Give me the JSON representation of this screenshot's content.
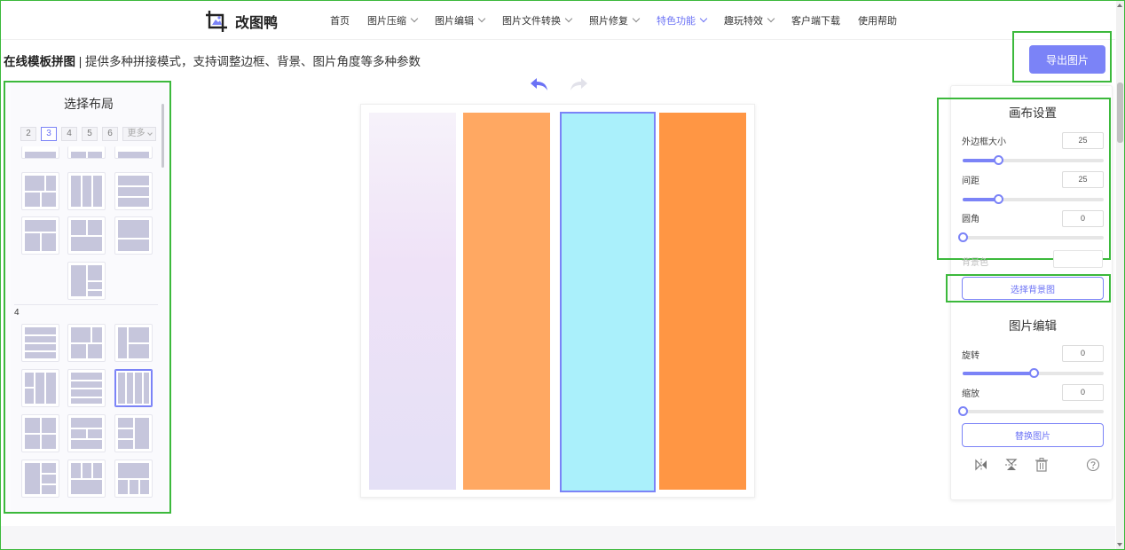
{
  "header": {
    "logo_text": "改图鸭",
    "nav": [
      {
        "label": "首页",
        "dropdown": false,
        "active": false
      },
      {
        "label": "图片压缩",
        "dropdown": true,
        "active": false
      },
      {
        "label": "图片编辑",
        "dropdown": true,
        "active": false
      },
      {
        "label": "图片文件转换",
        "dropdown": true,
        "active": false
      },
      {
        "label": "照片修复",
        "dropdown": true,
        "active": false
      },
      {
        "label": "特色功能",
        "dropdown": true,
        "active": true
      },
      {
        "label": "趣玩特效",
        "dropdown": true,
        "active": false
      },
      {
        "label": "客户端下载",
        "dropdown": false,
        "active": false
      },
      {
        "label": "使用帮助",
        "dropdown": false,
        "active": false
      }
    ],
    "accent_color": "#6b72f5"
  },
  "page": {
    "title_bold": "在线模板拼图",
    "title_rest": " | 提供多种拼接模式，支持调整边框、背景、图片角度等多种参数",
    "export_label": "导出图片"
  },
  "layout_panel": {
    "title": "选择布局",
    "count_tabs": [
      "2",
      "3",
      "4",
      "5",
      "6"
    ],
    "selected_count": "3",
    "more_label": "更多",
    "section_label": "4"
  },
  "canvas": {
    "tiles": [
      {
        "color_top": "#f6f2fa",
        "color_mid": "#efe2f7",
        "color_bottom": "#e4e0f6",
        "selected": false
      },
      {
        "color": "#ffa862",
        "selected": false
      },
      {
        "color": "#aaf0fb",
        "selected": true
      },
      {
        "color": "#ff9644",
        "selected": false
      }
    ]
  },
  "canvas_settings": {
    "title": "画布设置",
    "border_label": "外边框大小",
    "border_value": "25",
    "border_level": 0.25,
    "gap_label": "间距",
    "gap_value": "25",
    "gap_level": 0.25,
    "radius_label": "圆角",
    "radius_value": "0",
    "radius_level": 0,
    "bg_color_label": "背景色",
    "bg_image_label": "选择背景图"
  },
  "image_edit": {
    "title": "图片编辑",
    "rotate_label": "旋转",
    "rotate_value": "0",
    "rotate_level": 0.5,
    "zoom_label": "缩放",
    "zoom_value": "0",
    "zoom_level": 0,
    "replace_label": "替换图片",
    "icons": [
      "flip-horizontal-icon",
      "flip-vertical-icon",
      "trash-icon",
      "help-icon"
    ]
  }
}
